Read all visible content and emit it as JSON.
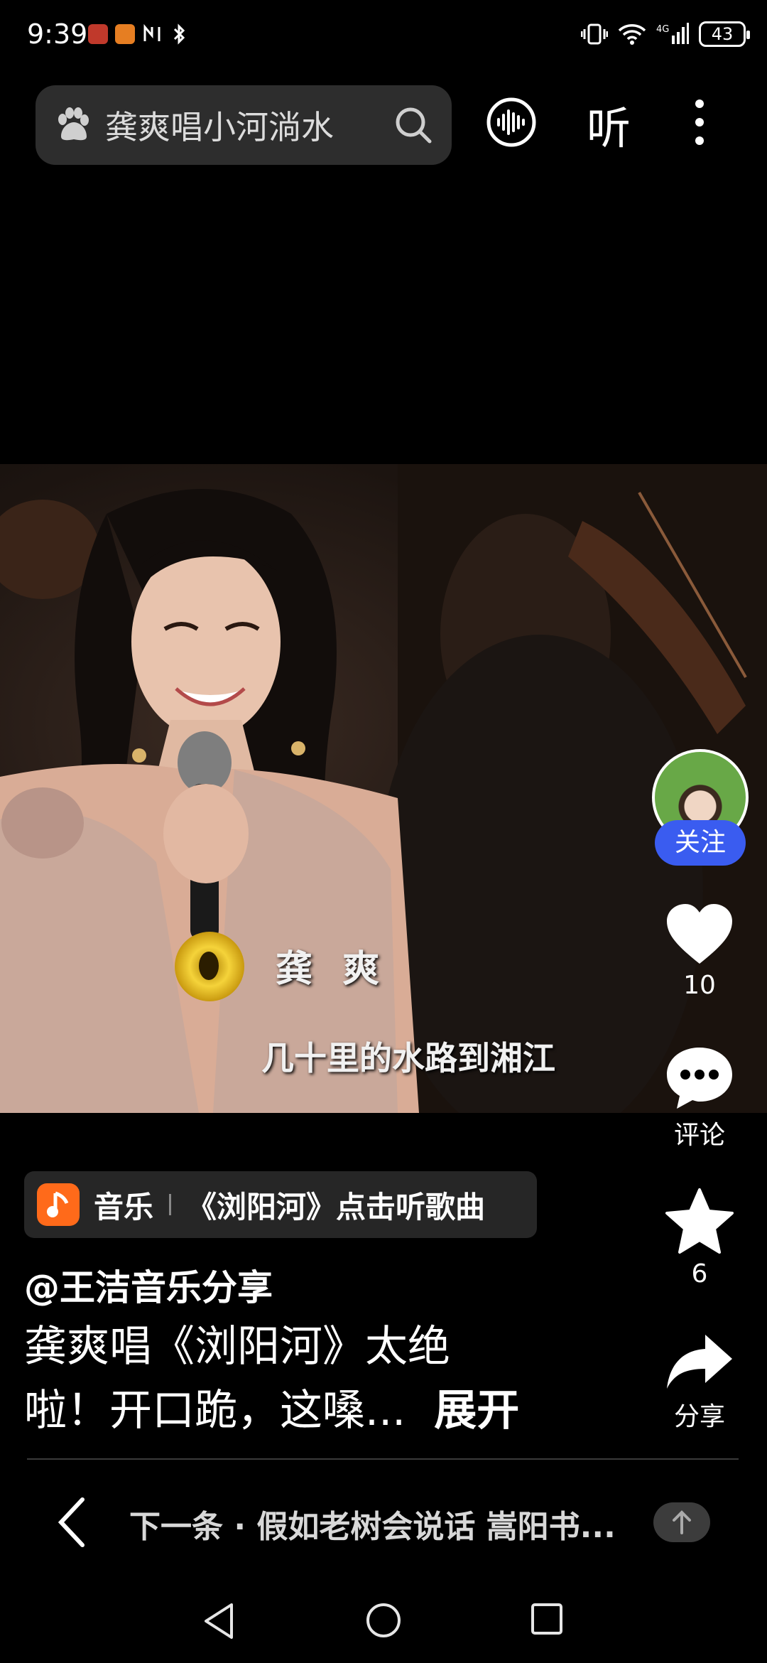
{
  "status": {
    "time": "9:39",
    "battery": "43",
    "network": "4G"
  },
  "search": {
    "query": "龚爽唱小河淌水"
  },
  "header": {
    "listen_label": "听"
  },
  "video": {
    "caption_name": "龚 爽",
    "caption_line": "几十里的水路到湘江"
  },
  "rail": {
    "follow_label": "关注",
    "like_count": "10",
    "comment_label": "评论",
    "favorite_count": "6",
    "share_label": "分享"
  },
  "music": {
    "label": "音乐",
    "song": "《浏阳河》点击听歌曲"
  },
  "post": {
    "author": "@王洁音乐分享",
    "desc_line1": "龚爽唱《浏阳河》太绝",
    "desc_line2": "啦！开口跪，这嗓...",
    "expand_label": "展开"
  },
  "next": {
    "text": "下一条 · 假如老树会说话 嵩阳书..."
  },
  "colors": {
    "follow": "#3a5cf0",
    "music_icon": "#ff6a1a",
    "background": "#000000"
  }
}
